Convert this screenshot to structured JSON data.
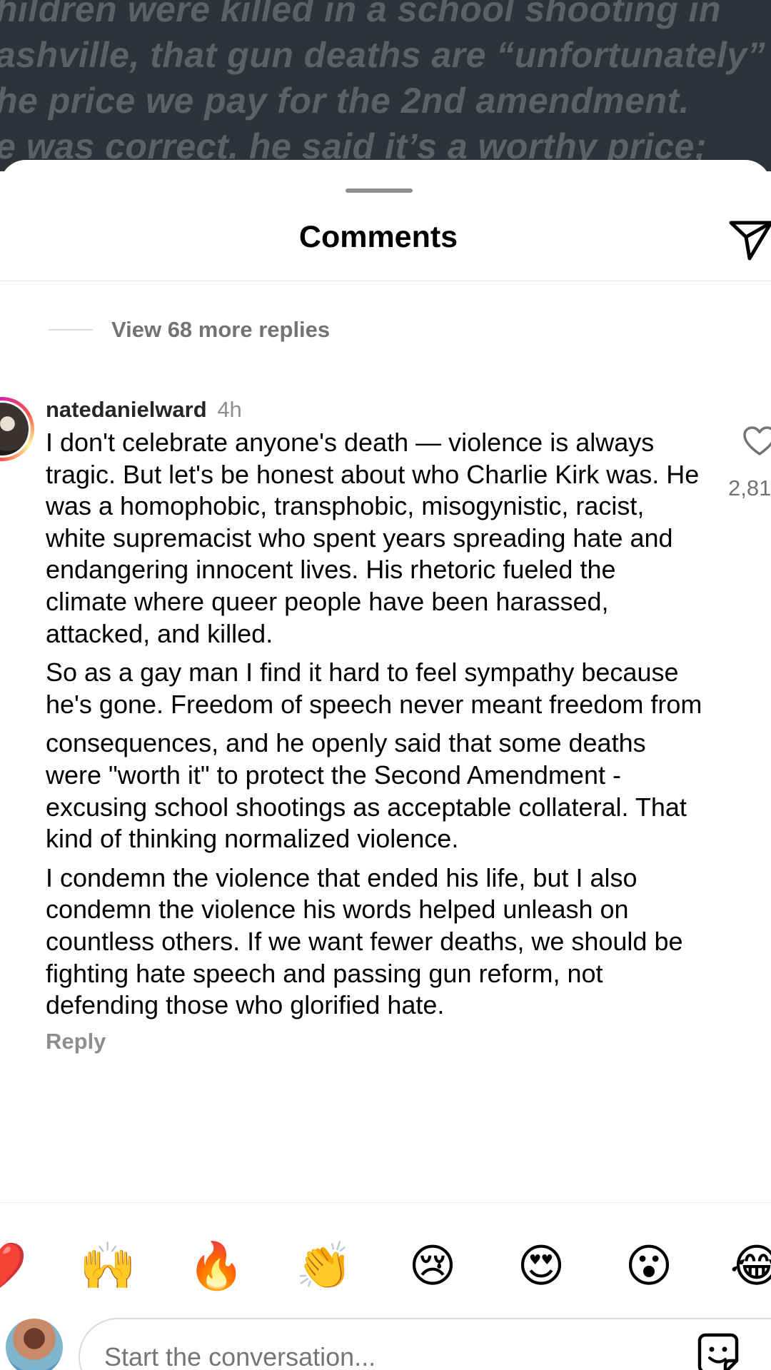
{
  "background_post": {
    "lines": [
      "hildren were killed in a school shooting in",
      "ashville, that gun deaths are “unfortunately”",
      "he price we pay for the 2nd amendment.",
      "e was correct. he said it’s a worthy price;"
    ]
  },
  "header": {
    "title": "Comments",
    "share_icon": "paper-plane-icon"
  },
  "thread": {
    "view_more_label": "View 68 more replies"
  },
  "comment": {
    "username": "natedanielward",
    "timestamp": "4h",
    "paragraphs": [
      "I don't celebrate anyone's death — violence is always tragic. But let's be honest about who Charlie Kirk was. He was a homophobic, transphobic, misogynistic, racist, white supremacist who spent years spreading hate and endangering innocent lives. His rhetoric fueled the climate where queer people have been harassed, attacked, and killed.",
      "So as a gay man I find it hard to feel sympathy because he's gone. Freedom of speech never meant freedom from",
      "consequences, and he openly said that some deaths were \"worth it\" to protect the Second Amendment - excusing school shootings as acceptable collateral. That kind of thinking normalized violence.",
      "I condemn the violence that ended his life, but I also condemn the violence his words helped unleash on countless others. If we want fewer deaths, we should be fighting hate speech and passing gun reform, not defending those who glorified hate."
    ],
    "reply_label": "Reply",
    "like_icon": "heart-outline-icon",
    "like_count": "2,81"
  },
  "emoji_bar": [
    {
      "name": "red-heart",
      "glyph": "❤️"
    },
    {
      "name": "raising-hands",
      "glyph": "🙌"
    },
    {
      "name": "fire",
      "glyph": "🔥"
    },
    {
      "name": "clapping-hands",
      "glyph": "👏"
    },
    {
      "name": "crying-face",
      "glyph": "😢"
    },
    {
      "name": "heart-eyes",
      "glyph": "😍"
    },
    {
      "name": "surprised-face",
      "glyph": "😮"
    },
    {
      "name": "tears-of-joy",
      "glyph": "😂"
    }
  ],
  "composer": {
    "placeholder": "Start the conversation...",
    "sticker_icon": "sticker-icon"
  }
}
